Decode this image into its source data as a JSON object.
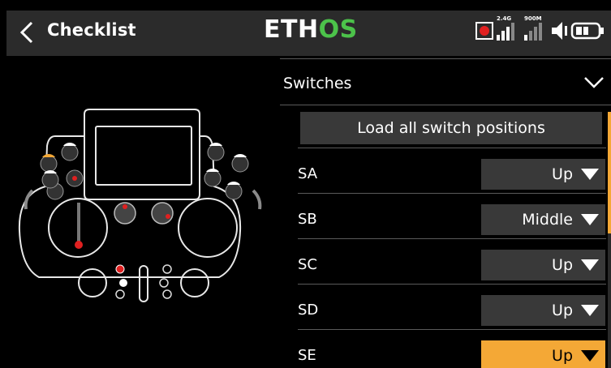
{
  "header": {
    "title": "Checklist",
    "logo_part1": "ETH",
    "logo_part2": "OS",
    "status": {
      "rf1_label": "2.4G",
      "rf2_label": "900M",
      "record_color": "#e02020"
    }
  },
  "section": {
    "label": "Switches",
    "expanded": true
  },
  "load_button": {
    "label": "Load all switch positions"
  },
  "switches": [
    {
      "name": "SA",
      "value": "Up",
      "active": false
    },
    {
      "name": "SB",
      "value": "Middle",
      "active": false
    },
    {
      "name": "SC",
      "value": "Up",
      "active": false
    },
    {
      "name": "SD",
      "value": "Up",
      "active": false
    },
    {
      "name": "SE",
      "value": "Up",
      "active": true
    }
  ],
  "colors": {
    "accent": "#f4a836",
    "logo_green": "#4cc24a",
    "header_bg": "#2b2b2b",
    "control_bg": "#393939",
    "switch_indicator": "#e02020"
  }
}
